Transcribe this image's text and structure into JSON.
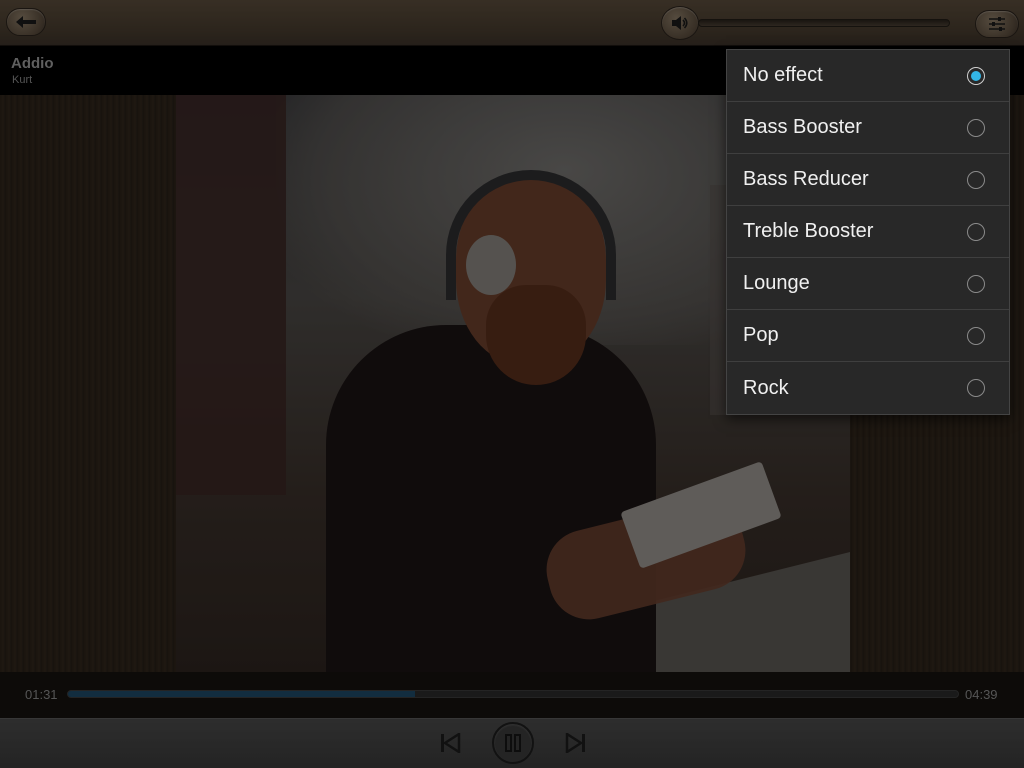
{
  "song": {
    "title": "Addio",
    "artist": "Kurt"
  },
  "playback": {
    "current_time": "01:31",
    "total_time": "04:39",
    "progress": 0.39
  },
  "volume": {
    "level": 0
  },
  "effects_menu": {
    "items": [
      {
        "label": "No effect",
        "selected": true
      },
      {
        "label": "Bass Booster",
        "selected": false
      },
      {
        "label": "Bass Reducer",
        "selected": false
      },
      {
        "label": "Treble Booster",
        "selected": false
      },
      {
        "label": "Lounge",
        "selected": false
      },
      {
        "label": "Pop",
        "selected": false
      },
      {
        "label": "Rock",
        "selected": false
      }
    ]
  },
  "colors": {
    "accent": "#33b5e5",
    "progress_fill": "#1e4a66"
  },
  "icons": {
    "back": "arrow-left-icon",
    "volume": "speaker-icon",
    "settings": "equalizer-icon",
    "prev": "skip-previous-icon",
    "play_pause": "pause-icon",
    "next": "skip-next-icon"
  }
}
